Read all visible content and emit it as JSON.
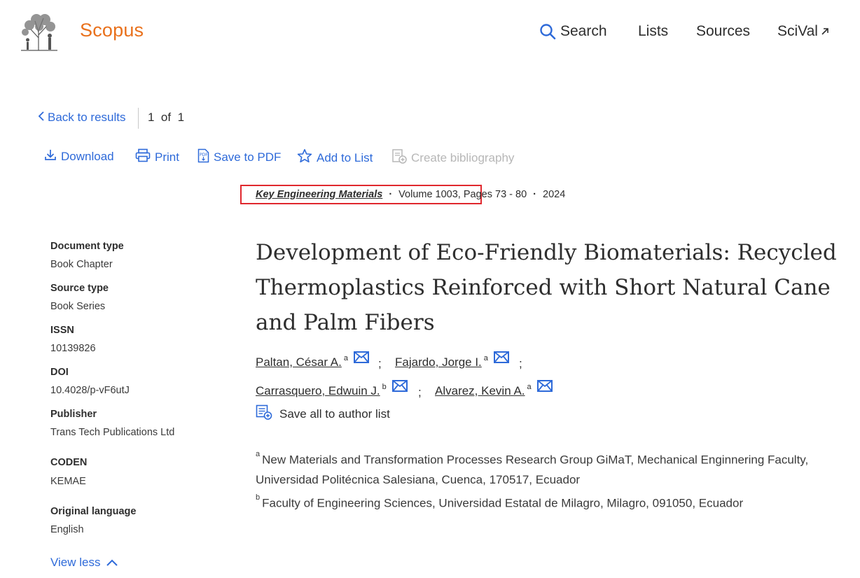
{
  "header": {
    "brand": "Scopus",
    "nav": {
      "search": "Search",
      "lists": "Lists",
      "sources": "Sources",
      "scival": "SciVal"
    }
  },
  "back_row": {
    "back_label": "Back to results",
    "pager_current": "1",
    "pager_of": "of",
    "pager_total": "1"
  },
  "toolbar": {
    "download": "Download",
    "print": "Print",
    "save_pdf": "Save to PDF",
    "add_list": "Add to List",
    "create_bib": "Create bibliography"
  },
  "source": {
    "journal": "Key Engineering Materials",
    "volume": "Volume 1003,",
    "pages": "Pages 73 - 80",
    "year": "2024"
  },
  "sidebar": {
    "items": [
      {
        "label": "Document type",
        "value": "Book Chapter"
      },
      {
        "label": "Source type",
        "value": "Book Series"
      },
      {
        "label": "ISSN",
        "value": "10139826"
      },
      {
        "label": "DOI",
        "value": "10.4028/p-vF6utJ"
      },
      {
        "label": "Publisher",
        "value": "Trans Tech Publications Ltd"
      },
      {
        "label": "CODEN",
        "value": "KEMAE"
      },
      {
        "label": "Original language",
        "value": "English"
      }
    ],
    "view_less": "View less"
  },
  "article": {
    "title": "Development of Eco-Friendly Biomaterials: Recycled Thermoplastics Reinforced with Short Natural Cane and Palm Fibers",
    "authors": [
      {
        "name": "Paltan, César A.",
        "aff": "a"
      },
      {
        "name": "Fajardo, Jorge I.",
        "aff": "a"
      },
      {
        "name": "Carrasquero, Edwuin J.",
        "aff": "b"
      },
      {
        "name": "Alvarez, Kevin A.",
        "aff": "a"
      }
    ],
    "separator": ";",
    "save_all": "Save all to author list",
    "affiliations": [
      {
        "key": "a",
        "text": "New Materials and Transformation Processes Research Group GiMaT, Mechanical Enginnering Faculty, Universidad Politécnica Salesiana, Cuenca, 170517, Ecuador"
      },
      {
        "key": "b",
        "text": "Faculty of Engineering Sciences, Universidad Estatal de Milagro, Milagro, 091050, Ecuador"
      }
    ]
  },
  "colors": {
    "brand": "#e9711c",
    "link": "#2e6ad9",
    "highlight": "#e0282e"
  },
  "icons": [
    "elsevier-tree-logo",
    "search-icon",
    "external-arrow-icon",
    "chevron-left-icon",
    "download-icon",
    "print-icon",
    "pdf-icon",
    "star-icon",
    "bibliography-icon",
    "mail-icon",
    "author-list-icon",
    "chevron-up-icon"
  ]
}
